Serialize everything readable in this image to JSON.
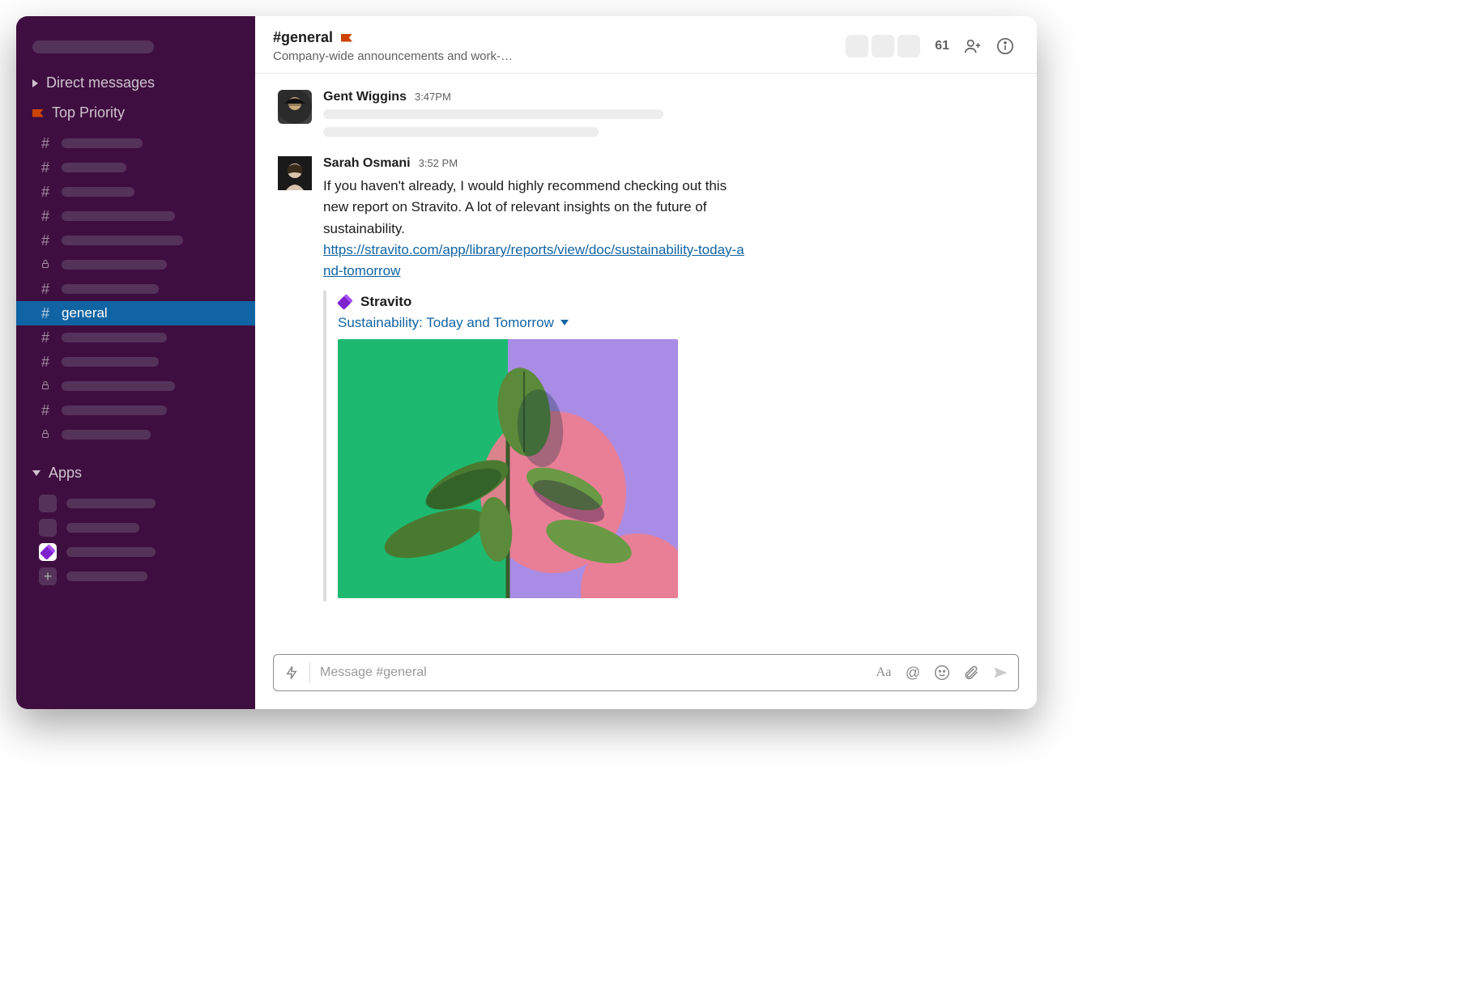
{
  "sidebar": {
    "direct_messages_label": "Direct messages",
    "top_priority_label": "Top Priority",
    "apps_label": "Apps",
    "channels": [
      {
        "type": "hash",
        "active": false
      },
      {
        "type": "hash",
        "active": false
      },
      {
        "type": "hash",
        "active": false
      },
      {
        "type": "hash",
        "active": false
      },
      {
        "type": "hash",
        "active": false
      },
      {
        "type": "lock",
        "active": false
      },
      {
        "type": "hash",
        "active": false
      },
      {
        "type": "hash",
        "active": true,
        "name": "general"
      },
      {
        "type": "hash",
        "active": false
      },
      {
        "type": "hash",
        "active": false
      },
      {
        "type": "lock",
        "active": false
      },
      {
        "type": "hash",
        "active": false
      },
      {
        "type": "lock",
        "active": false
      }
    ]
  },
  "header": {
    "channel_name": "#general",
    "topic": "Company-wide announcements and work-…",
    "member_count": "61"
  },
  "messages": [
    {
      "author": "Gent Wiggins",
      "time": "3:47PM"
    },
    {
      "author": "Sarah Osmani",
      "time": "3:52 PM",
      "text": "If you haven't already, I would highly recommend checking out this new report on Stravito.  A lot of relevant insights on the future of sustainability.",
      "link": "https://stravito.com/app/library/reports/view/doc/sustainability-today-and-tomorrow",
      "attachment": {
        "app_name": "Stravito",
        "title": "Sustainability: Today and Tomorrow"
      }
    }
  ],
  "composer": {
    "placeholder": "Message #general"
  }
}
